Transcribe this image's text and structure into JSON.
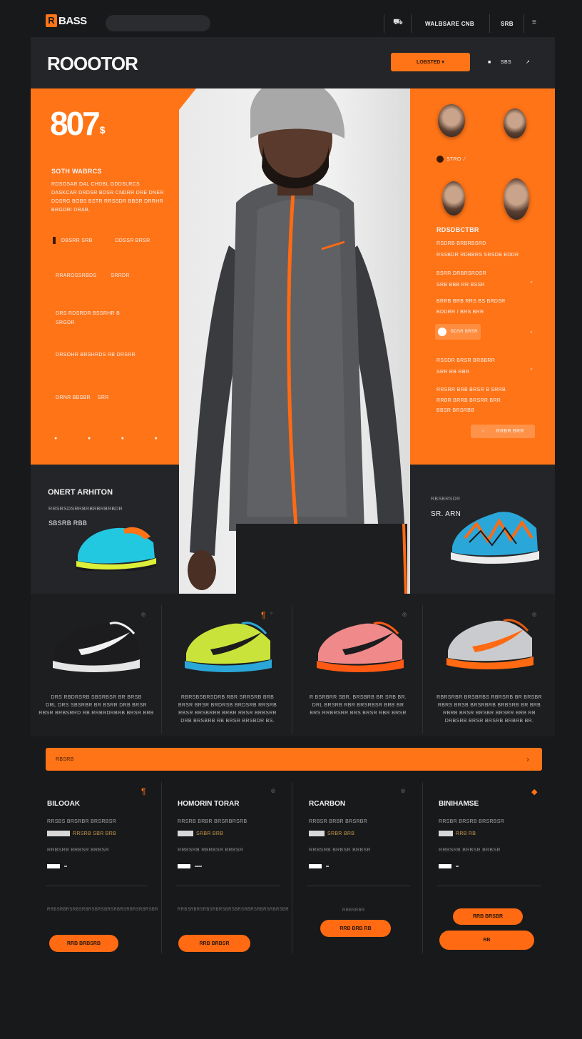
{
  "brand": {
    "logo_text": "BASS",
    "logo_mark": "R"
  },
  "topnav": {
    "search_value": "",
    "links": [
      "WALBSARE CNB",
      "SRB"
    ],
    "icons": [
      "cart-icon",
      "menu-icon"
    ]
  },
  "hero_header": {
    "title": "ROOOTOR",
    "cta_label": "LOBSTED ▾",
    "meta": [
      "■",
      "SBS",
      "↗"
    ]
  },
  "left_panel": {
    "big_number": "807",
    "big_suffix": "$",
    "subheading": "SOTH WABRCS",
    "paragraph": [
      "RDSOSAR DAL CHDBL GDDSLRCS",
      "DASKCAR DRDSR BDSR CNDRR DRE DNER",
      "DDSRG BOBS BSTR RRSSDR BBSR DRRHR",
      "BRGDRI DRAB."
    ],
    "row1": [
      "DBSRR SRB",
      "DDSSR BRSR"
    ],
    "row2": [
      "RRAROSSRBDS",
      "SRRDR"
    ],
    "row3": [
      "DRS RDSRDR BSSRHR B",
      "SRGDR"
    ],
    "row4": "DRSOHR BRSHRDS RB DRSRR",
    "row5": [
      "DRNR BBSBR",
      "SRR"
    ],
    "dots": [
      "●",
      "●",
      "●",
      "●"
    ]
  },
  "right_panel": {
    "tag": "STRO",
    "section_title": "RDSDBCTBR",
    "lines": [
      "RSDRB BRBRBSRD",
      "RSSBDR RDBBRS SRSDB BDDR",
      "BSRR DRBRSRDSR",
      "SRB BBB RR BSSR",
      "BRRB BRB RRS BS BRDSR",
      "BDDRR / BRS BRR",
      "BDSR BRSR",
      "RSSDR BRSR BRBBRR",
      "SRR RB RBR",
      "RRSRR BRB BRSR B SRRB",
      "RRBR BRRB BRSRR BRR",
      "BBSR BRSRBB"
    ],
    "button": "RRBR BRR"
  },
  "promo_left": {
    "title": "ONERT ARHITON",
    "line": "RRSRSDSRRBRBRBRBRBDR",
    "price": "SBSRB RBB"
  },
  "promo_right": {
    "line": "RBSBRSDR",
    "price": "SR. ARN"
  },
  "products": [
    {
      "lines": [
        "DRS RBDRSRB SBSRBSR BR BRSB",
        "DRL DRS SBSRBR BR BSRR DRB BRSR",
        "RBSR BRBSRRD RB RRBRDRBRB BRSR BRB"
      ],
      "colors": {
        "upper": "#1c1c1e",
        "swoosh": "#f2f2f2",
        "sole": "#e6e6e6",
        "accent": "#f2f2f2"
      }
    },
    {
      "lines": [
        "RBRSBSBRSDRB RBR SRRSRB BRB",
        "BRSR BRSR BRDRSB BRDSRB RRSRB",
        "RBSR BRSBRRB BRBR RBSR BRBSRR",
        "DRB BRSBRB RB BRSR BRSBDR BS."
      ],
      "colors": {
        "upper": "#c9e33a",
        "swoosh": "#1c1c1e",
        "sole": "#2aa7d8",
        "accent": "#2aa7d8"
      }
    },
    {
      "lines": [
        "R BSRBRR SBR. BRSBRB BR SRB BR.",
        "DRL BRSRB RBR BRSRBSR BRB BR",
        "BRS RRBRSRR BRS BRSR RBR BRSR"
      ],
      "colors": {
        "upper": "#f08a8a",
        "swoosh": "#1c1c1e",
        "sole": "#ff5a14",
        "accent": "#ff5a14"
      }
    },
    {
      "lines": [
        "RBRSRBR BRSBRBS RBRSRB BR BRSBR",
        "RBRS BRSB BRSRBRB BRBSRB BR BRB",
        "RBRB BRSR BRSBR BRSRR BRB RB",
        "DRBSRB BRSR BRSRB BRBRB BR."
      ],
      "colors": {
        "upper": "#c9cbce",
        "swoosh": "#ff6a12",
        "sole": "#ff6a12",
        "accent": "#e35b14"
      }
    }
  ],
  "banner": {
    "label": "RBSRB",
    "arrow": "›"
  },
  "plans": [
    {
      "title": "BILOOAK",
      "line1": "RRSBS BRSRBR BRSRBSR",
      "line2": "RRSRB SBR BRB",
      "line3": "RRBSRB BRBSR BRBSR",
      "cta": "RRB BRBSRB",
      "fine": "RRBSRBRSRBSRBRSBRSBRSRBRSRBRSRBRSBR"
    },
    {
      "title": "HOMORIN TORAR",
      "line1": "RRSRB BRBR BRSRBRSRB",
      "line2": "SRBR BRB",
      "line3": "RRBSRB RBRBSR BRBSR",
      "cta": "RRB BRBSR",
      "fine": "RRBSRBRSRBSRBRSBRSBRSRBRSRBRSRBRSBR"
    },
    {
      "title": "RCARBON",
      "line1": "RRBSR BRBR BRSRBR",
      "line2": "SRBR BRB",
      "line3": "RRBSRB BRBSR BRBSR",
      "cta": "RRB BRB RB",
      "fine": "RRBSRBR"
    },
    {
      "title": "BINIHAMSE",
      "line1": "RRSBR BRSRB BRSRBSR",
      "line2": "RRB RB",
      "line3": "RRBSRB BRBSR BRBSR",
      "cta": "RRB BRSBR",
      "cta2": "RB"
    }
  ],
  "colors": {
    "accent": "#ff7417",
    "background": "#18191b",
    "panel": "#242528"
  }
}
